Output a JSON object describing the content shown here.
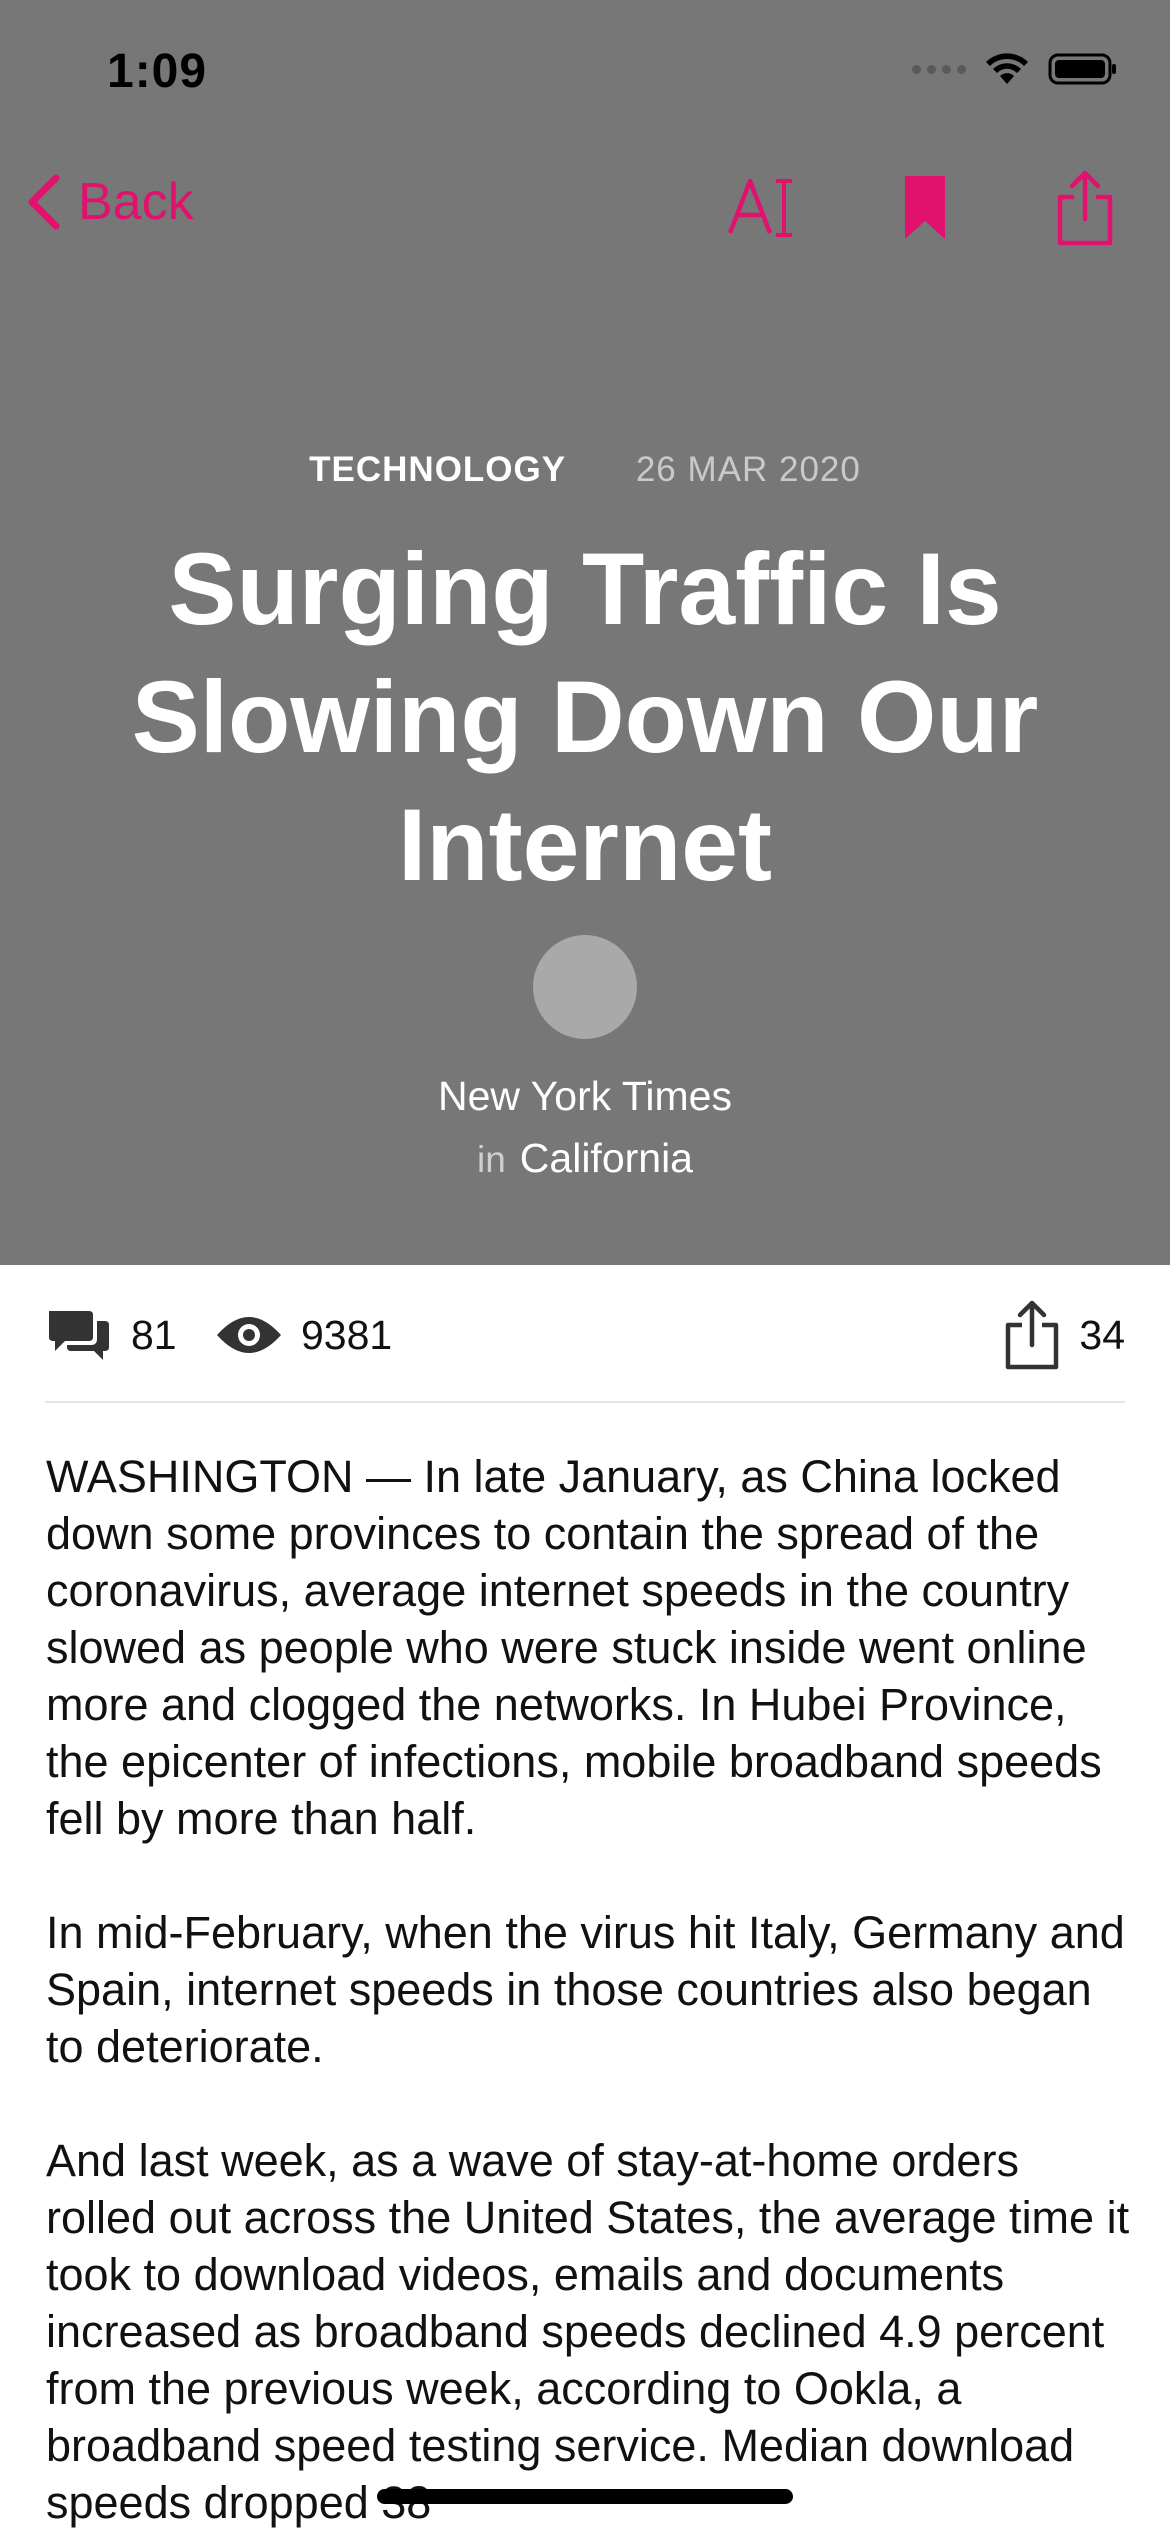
{
  "status_bar": {
    "time": "1:09"
  },
  "nav": {
    "back_label": "Back",
    "icons": [
      "chevron-left-icon",
      "text-size-icon",
      "bookmark-icon",
      "share-icon"
    ]
  },
  "article": {
    "category": "TECHNOLOGY",
    "date": "26 MAR 2020",
    "title": "Surging Traffic Is Slowing Down Our Internet",
    "author": {
      "name": "New York Times",
      "location_prefix": "in",
      "location": "California"
    },
    "stats": {
      "comments": "81",
      "views": "9381",
      "shares": "34"
    },
    "paragraphs": [
      "WASHINGTON — In late January, as China locked down some provinces to contain the spread of the coronavirus, average internet speeds in the country slowed as people who were stuck inside went online more and clogged the networks. In Hubei Province, the epicenter of infections, mobile broadband speeds fell by more than half.",
      "In mid-February, when the virus hit Italy, Germany and Spain, internet speeds in those countries also began to deteriorate.",
      "And last week, as a wave of stay-at-home orders rolled out across the United States, the average time it took to download videos, emails and documents increased as broadband speeds declined 4.9 percent from the previous week, according to Ookla, a broadband speed testing service. Median download speeds dropped 38"
    ]
  },
  "colors": {
    "accent": "#E0126E",
    "hero_background": "#777777",
    "avatar_placeholder": "#A9A9A9"
  }
}
